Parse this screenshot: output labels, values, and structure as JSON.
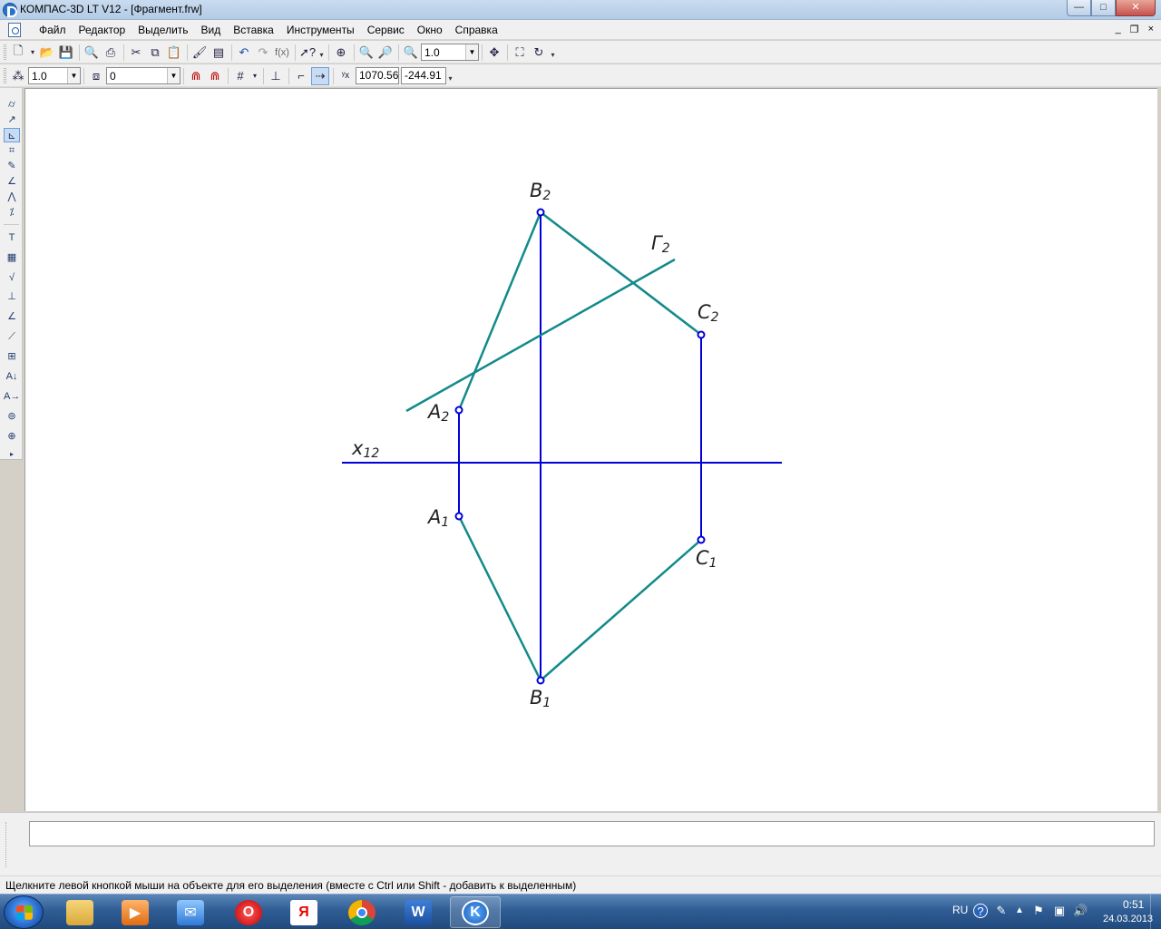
{
  "window": {
    "title": "КОМПАС-3D LT V12 - [Фрагмент.frw]",
    "buttons": {
      "minimize": "—",
      "maximize": "□",
      "close": "✕"
    }
  },
  "menu": {
    "items": [
      "Файл",
      "Редактор",
      "Выделить",
      "Вид",
      "Вставка",
      "Инструменты",
      "Сервис",
      "Окно",
      "Справка"
    ],
    "mdi": {
      "minimize": "_",
      "restore": "❐",
      "close": "×"
    }
  },
  "toolbar1": {
    "zoom_value": "1.0"
  },
  "toolbar2": {
    "step_value": "1.0",
    "layer_value": "0",
    "coord_x": "1070.56",
    "coord_y": "-244.91"
  },
  "drawing": {
    "labels": {
      "B2": {
        "letter": "B",
        "index": "2"
      },
      "G2": {
        "letter": "Г",
        "index": "2"
      },
      "C2": {
        "letter": "C",
        "index": "2"
      },
      "A2": {
        "letter": "A",
        "index": "2"
      },
      "x12": {
        "letter": "x",
        "index": "12"
      },
      "A1": {
        "letter": "A",
        "index": "1"
      },
      "C1": {
        "letter": "C",
        "index": "1"
      },
      "B1": {
        "letter": "B",
        "index": "1"
      }
    },
    "colors": {
      "projection_lines": "#0000d8",
      "object_lines": "#138a8a",
      "point_marker": "#0000d8"
    }
  },
  "statusbar": {
    "text": "Щелкните левой кнопкой мыши на объекте для его выделения (вместе с Ctrl или Shift - добавить к выделенным)"
  },
  "taskbar": {
    "language": "RU",
    "time": "0:51",
    "date": "24.03.2013",
    "apps": [
      {
        "name": "explorer",
        "active": false
      },
      {
        "name": "media-player",
        "active": false
      },
      {
        "name": "mail",
        "active": false
      },
      {
        "name": "opera",
        "active": false,
        "glyph": "O"
      },
      {
        "name": "yandex",
        "active": false,
        "glyph": "Я"
      },
      {
        "name": "chrome",
        "active": false
      },
      {
        "name": "word",
        "active": false,
        "glyph": "W"
      },
      {
        "name": "kompas",
        "active": true
      }
    ]
  }
}
